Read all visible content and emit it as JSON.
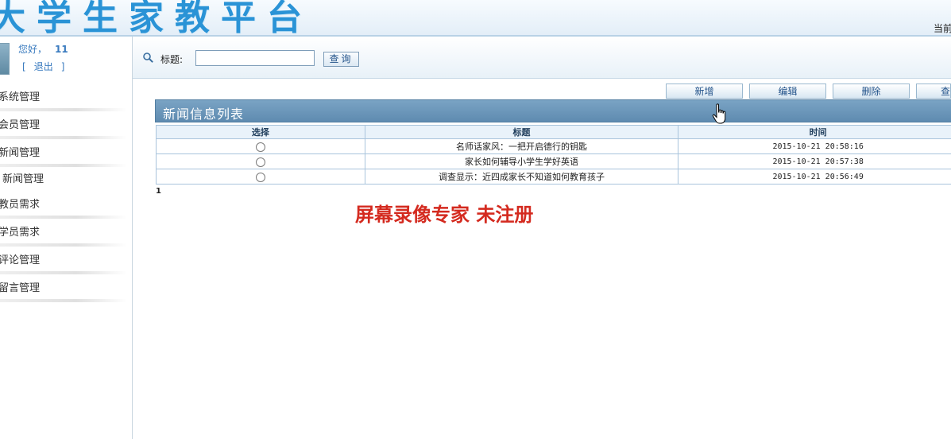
{
  "header": {
    "logo_text": "大学生家教平台",
    "current_position": "当前"
  },
  "sidebar": {
    "greeting": "您好，",
    "username": "11",
    "logout_open": "[",
    "logout": "退出",
    "logout_close": "]",
    "items": [
      {
        "label": "系统管理"
      },
      {
        "label": "会员管理"
      },
      {
        "label": "新闻管理"
      },
      {
        "label": "新闻管理"
      },
      {
        "label": "教员需求"
      },
      {
        "label": "学员需求"
      },
      {
        "label": "评论管理"
      },
      {
        "label": "留言管理"
      }
    ]
  },
  "search": {
    "label": "标题:",
    "value": "",
    "button": "查询"
  },
  "toolbar": {
    "add": "新增",
    "edit": "编辑",
    "delete": "删除",
    "view": "查"
  },
  "panel": {
    "title": "新闻信息列表",
    "columns": {
      "select": "选择",
      "title": "标题",
      "time": "时间"
    },
    "rows": [
      {
        "title": "名师话家风：一把开启德行的钥匙",
        "time": "2015-10-21 20:58:16"
      },
      {
        "title": "家长如何辅导小学生学好英语",
        "time": "2015-10-21 20:57:38"
      },
      {
        "title": "调查显示：近四成家长不知道如何教育孩子",
        "time": "2015-10-21 20:56:49"
      }
    ],
    "page": "1"
  },
  "watermark": "屏幕录像专家  未注册",
  "colors": {
    "brand": "#2a93d6",
    "panel_header": "#6991b4",
    "watermark": "#d42a1f"
  }
}
